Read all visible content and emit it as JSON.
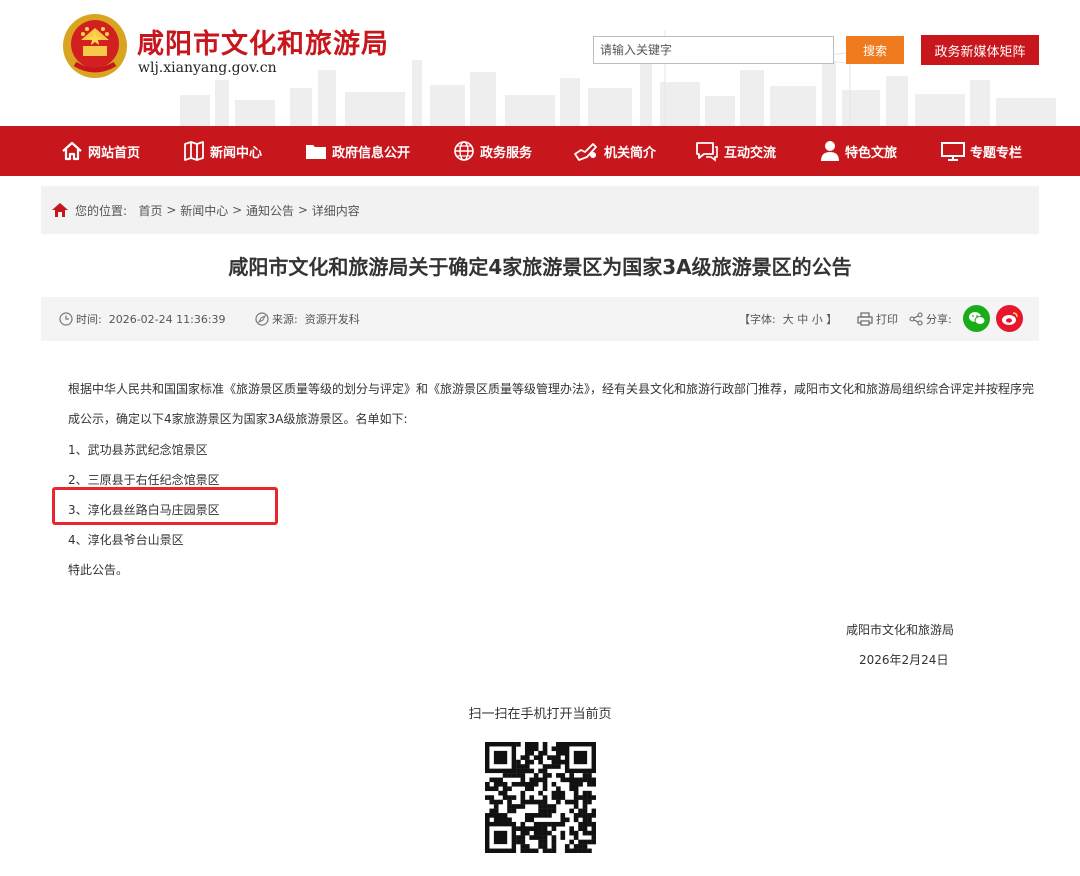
{
  "header": {
    "site_title": "咸阳市文化和旅游局",
    "site_url": "wlj.xianyang.gov.cn",
    "search_placeholder": "请输入关键字",
    "search_button": "搜索",
    "media_button": "政务新媒体矩阵"
  },
  "nav": {
    "items": [
      {
        "label": "网站首页",
        "icon": "home-icon"
      },
      {
        "label": "新闻中心",
        "icon": "book-icon"
      },
      {
        "label": "政府信息公开",
        "icon": "folder-icon"
      },
      {
        "label": "政务服务",
        "icon": "globe-icon"
      },
      {
        "label": "机关简介",
        "icon": "hand-icon"
      },
      {
        "label": "互动交流",
        "icon": "chat-icon"
      },
      {
        "label": "特色文旅",
        "icon": "person-icon"
      },
      {
        "label": "专题专栏",
        "icon": "monitor-icon"
      }
    ]
  },
  "breadcrumb": {
    "prefix": "您的位置:",
    "items": [
      "首页",
      "新闻中心",
      "通知公告",
      "详细内容"
    ],
    "separator": ">"
  },
  "article": {
    "title": "咸阳市文化和旅游局关于确定4家旅游景区为国家3A级旅游景区的公告",
    "meta": {
      "time_label": "时间:",
      "time_value": "2026-02-24 11:36:39",
      "source_label": "来源:",
      "source_value": "资源开发科",
      "font_label": "【字体:",
      "font_large": "大",
      "font_medium": "中",
      "font_small": "小",
      "font_close": "】",
      "print_label": "打印",
      "share_label": "分享:"
    },
    "paragraph": "根据中华人民共和国国家标准《旅游景区质量等级的划分与评定》和《旅游景区质量等级管理办法》，经有关县文化和旅游行政部门推荐，咸阳市文化和旅游局组织综合评定并按程序完成公示，确定以下4家旅游景区为国家3A级旅游景区。名单如下:",
    "list": [
      "1、武功县苏武纪念馆景区",
      "2、三原县于右任纪念馆景区",
      "3、淳化县丝路白马庄园景区",
      "4、淳化县爷台山景区"
    ],
    "closing": "特此公告。",
    "signature_org": "咸阳市文化和旅游局",
    "signature_date": "2026年2月24日"
  },
  "qr": {
    "label": "扫一扫在手机打开当前页"
  },
  "colors": {
    "brand_red": "#c8161d",
    "search_orange": "#f07a1e",
    "highlight_red": "#e8262b",
    "wechat_green": "#1aad19",
    "weibo_red": "#e6162d"
  }
}
